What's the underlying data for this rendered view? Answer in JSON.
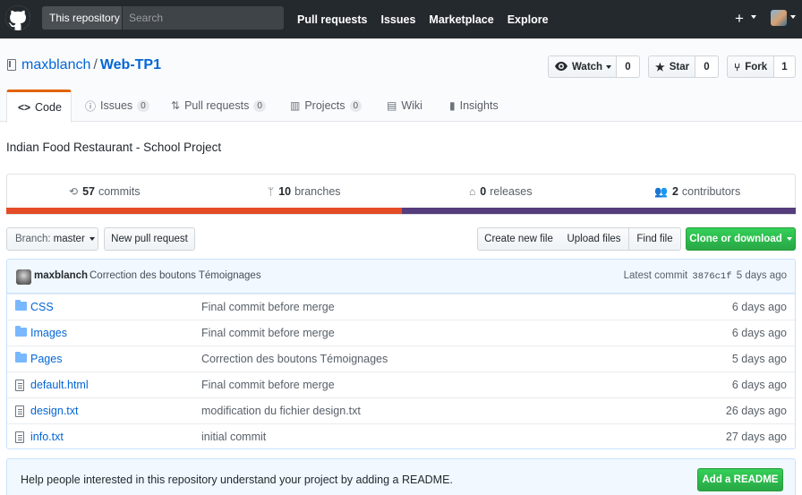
{
  "header": {
    "search_scope": "This repository",
    "search_placeholder": "Search",
    "nav": [
      "Pull requests",
      "Issues",
      "Marketplace",
      "Explore"
    ],
    "plus_glyph": "+"
  },
  "repo": {
    "owner": "maxblanch",
    "separator": "/",
    "name": "Web-TP1",
    "watch_label": "Watch",
    "watch_count": "0",
    "star_label": "Star",
    "star_count": "0",
    "fork_label": "Fork",
    "fork_count": "1"
  },
  "tabs": [
    {
      "label": "Code",
      "icon": "code-icon",
      "glyph": "<>",
      "counter": ""
    },
    {
      "label": "Issues",
      "icon": "issue-icon",
      "glyph": "ⓘ",
      "counter": "0"
    },
    {
      "label": "Pull requests",
      "icon": "pull-request-icon",
      "glyph": "⇅",
      "counter": "0"
    },
    {
      "label": "Projects",
      "icon": "project-icon",
      "glyph": "▥",
      "counter": "0"
    },
    {
      "label": "Wiki",
      "icon": "wiki-icon",
      "glyph": "▤",
      "counter": ""
    },
    {
      "label": "Insights",
      "icon": "graph-icon",
      "glyph": "▮",
      "counter": ""
    }
  ],
  "description": "Indian Food Restaurant - School Project",
  "summary": {
    "commits_num": "57",
    "commits_label": "commits",
    "branches_num": "10",
    "branches_label": "branches",
    "releases_num": "0",
    "releases_label": "releases",
    "contributors_num": "2",
    "contributors_label": "contributors"
  },
  "languages": {
    "css_color": "#e34c26",
    "html_color": "#563d7c"
  },
  "filenav": {
    "branch_label": "Branch:",
    "branch_value": "master",
    "new_pr": "New pull request",
    "create_file": "Create new file",
    "upload_files": "Upload files",
    "find_file": "Find file",
    "clone": "Clone or download"
  },
  "commit": {
    "author": "maxblanch",
    "message": "Correction des boutons Témoignages",
    "latest_label": "Latest commit",
    "sha": "3876c1f",
    "age": "5 days ago"
  },
  "files": [
    {
      "type": "folder",
      "name": "CSS",
      "message": "Final commit before merge",
      "age": "6 days ago"
    },
    {
      "type": "folder",
      "name": "Images",
      "message": "Final commit before merge",
      "age": "6 days ago"
    },
    {
      "type": "folder",
      "name": "Pages",
      "message": "Correction des boutons Témoignages",
      "age": "5 days ago"
    },
    {
      "type": "file",
      "name": "default.html",
      "message": "Final commit before merge",
      "age": "6 days ago"
    },
    {
      "type": "file",
      "name": "design.txt",
      "message": "modification du fichier design.txt",
      "age": "26 days ago"
    },
    {
      "type": "file",
      "name": "info.txt",
      "message": "initial commit",
      "age": "27 days ago"
    }
  ],
  "readme": {
    "text": "Help people interested in this repository understand your project by adding a README.",
    "button": "Add a README"
  }
}
